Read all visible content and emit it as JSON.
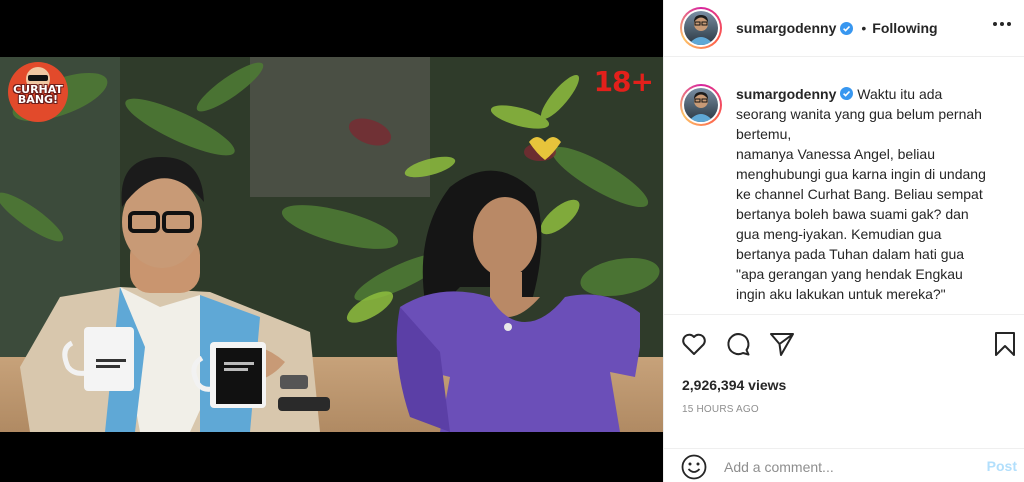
{
  "media": {
    "logo_text_top": "CURHAT",
    "logo_text_bottom": "BANG!",
    "rating_badge": "18+"
  },
  "post": {
    "author": "sumargodenny",
    "follow_status": "Following",
    "separator": "•",
    "caption_lines": [
      "Waktu itu ada",
      "seorang wanita yang gua belum pernah",
      "bertemu,",
      "namanya Vanessa Angel, beliau",
      "menghubungi gua karna ingin di undang",
      "ke channel Curhat Bang. Beliau sempat",
      "bertanya boleh bawa suami gak? dan",
      "gua meng-iyakan. Kemudian gua",
      "bertanya pada Tuhan dalam hati gua",
      "\"apa gerangan yang hendak Engkau",
      "ingin aku lakukan untuk mereka?\""
    ],
    "views": "2,926,394 views",
    "timestamp": "15 HOURS AGO"
  },
  "comment": {
    "placeholder": "Add a comment...",
    "post_label": "Post"
  },
  "icons": {
    "verified": "verified-badge-icon",
    "like": "heart-icon",
    "comment": "comment-bubble-icon",
    "share": "paper-plane-icon",
    "save": "bookmark-icon",
    "emoji": "smiley-icon",
    "more": "more-options-icon"
  },
  "colors": {
    "verified_blue": "#3897f0",
    "post_button_inactive": "#b2dffc",
    "rating_red": "#e3201b",
    "muted_text": "#8e8e8e"
  }
}
